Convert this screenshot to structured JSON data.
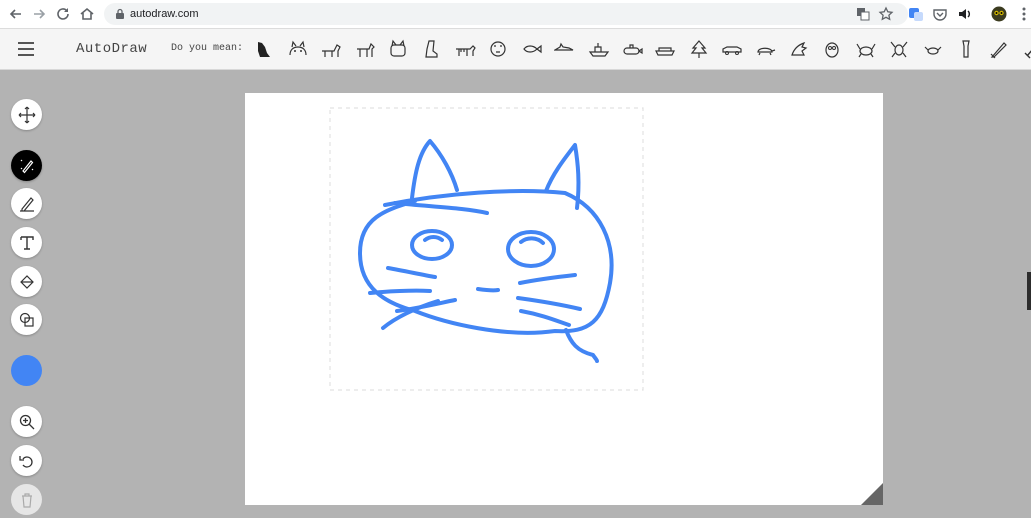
{
  "browser": {
    "url": "autodraw.com",
    "icons": [
      "back-icon",
      "forward-icon",
      "reload-icon",
      "home-icon",
      "lock-icon",
      "translate-icon",
      "star-icon",
      "google-translate-icon",
      "pocket-icon",
      "volume-icon",
      "profile-avatar-icon",
      "more-vert-icon"
    ]
  },
  "app": {
    "title": "AutoDraw",
    "suggestions_label": "Do you mean:",
    "suggestions": [
      "bear",
      "cat",
      "dog",
      "horse",
      "cat-face",
      "boot",
      "tiger",
      "tiger-face",
      "fish",
      "shark",
      "ship",
      "submarine",
      "boat",
      "tree",
      "car",
      "turtle",
      "dragon",
      "owl",
      "crab",
      "lobster",
      "crab-2",
      "flashlight",
      "sword",
      "sword-2"
    ]
  },
  "toolbar": {
    "tools": [
      "select",
      "autodraw",
      "draw",
      "type",
      "fill",
      "shape"
    ],
    "active_tool": "autodraw",
    "stroke_color": "#4285f4",
    "actions": [
      "zoom",
      "undo",
      "delete"
    ]
  },
  "canvas": {
    "background": "#ffffff",
    "stroke_color": "#4285f4"
  }
}
